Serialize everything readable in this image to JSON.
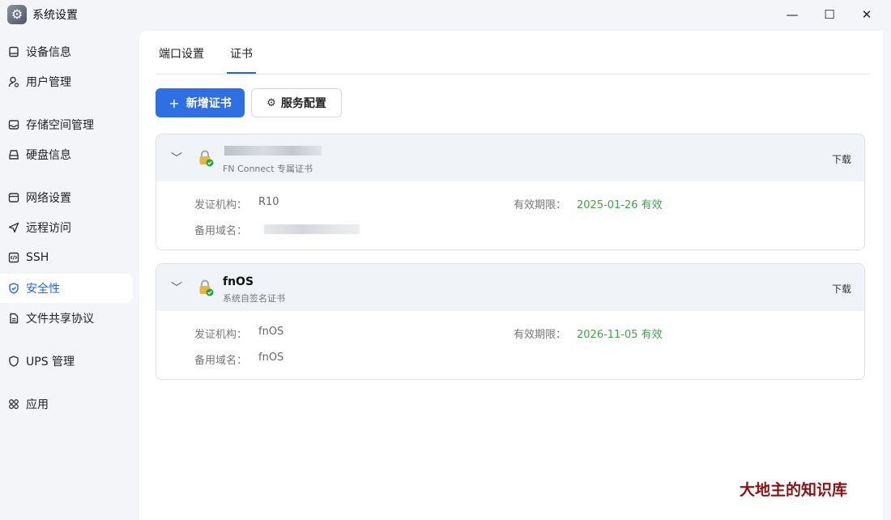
{
  "window": {
    "title": "系统设置",
    "min_glyph": "—",
    "max_glyph": "☐",
    "close_glyph": "✕"
  },
  "sidebar": {
    "items": [
      {
        "label": "设备信息",
        "icon": "device-icon"
      },
      {
        "label": "用户管理",
        "icon": "user-icon"
      },
      {
        "label": "存储空间管理",
        "icon": "storage-icon"
      },
      {
        "label": "硬盘信息",
        "icon": "disk-icon"
      },
      {
        "label": "网络设置",
        "icon": "network-icon"
      },
      {
        "label": "远程访问",
        "icon": "send-icon"
      },
      {
        "label": "SSH",
        "icon": "code-icon"
      },
      {
        "label": "安全性",
        "icon": "shield-icon",
        "active": true
      },
      {
        "label": "文件共享协议",
        "icon": "file-icon"
      },
      {
        "label": "UPS 管理",
        "icon": "ups-shield-icon"
      },
      {
        "label": "应用",
        "icon": "apps-icon"
      }
    ]
  },
  "tabs": [
    {
      "label": "端口设置"
    },
    {
      "label": "证书",
      "active": true
    }
  ],
  "toolbar": {
    "add_label": "新增证书",
    "service_label": "服务配置"
  },
  "certificates": [
    {
      "name": "",
      "name_blurred": true,
      "subtitle": "FN Connect 专属证书",
      "download": "下载",
      "issuer_label": "发证机构：",
      "issuer": "R10",
      "validity_label": "有效期限：",
      "validity": "2025-01-26 有效",
      "alt_label": "备用域名：",
      "alt": "",
      "alt_blurred": true
    },
    {
      "name": "fnOS",
      "subtitle": "系统自签名证书",
      "download": "下载",
      "issuer_label": "发证机构：",
      "issuer": "fnOS",
      "validity_label": "有效期限：",
      "validity": "2026-11-05 有效",
      "alt_label": "备用域名：",
      "alt": "fnOS"
    }
  ],
  "watermark": "大地主的知识库",
  "colors": {
    "accent": "#2563eb",
    "primary_button": "#2f6fe4",
    "valid_green": "#3fa24a",
    "watermark": "#8b1212"
  }
}
